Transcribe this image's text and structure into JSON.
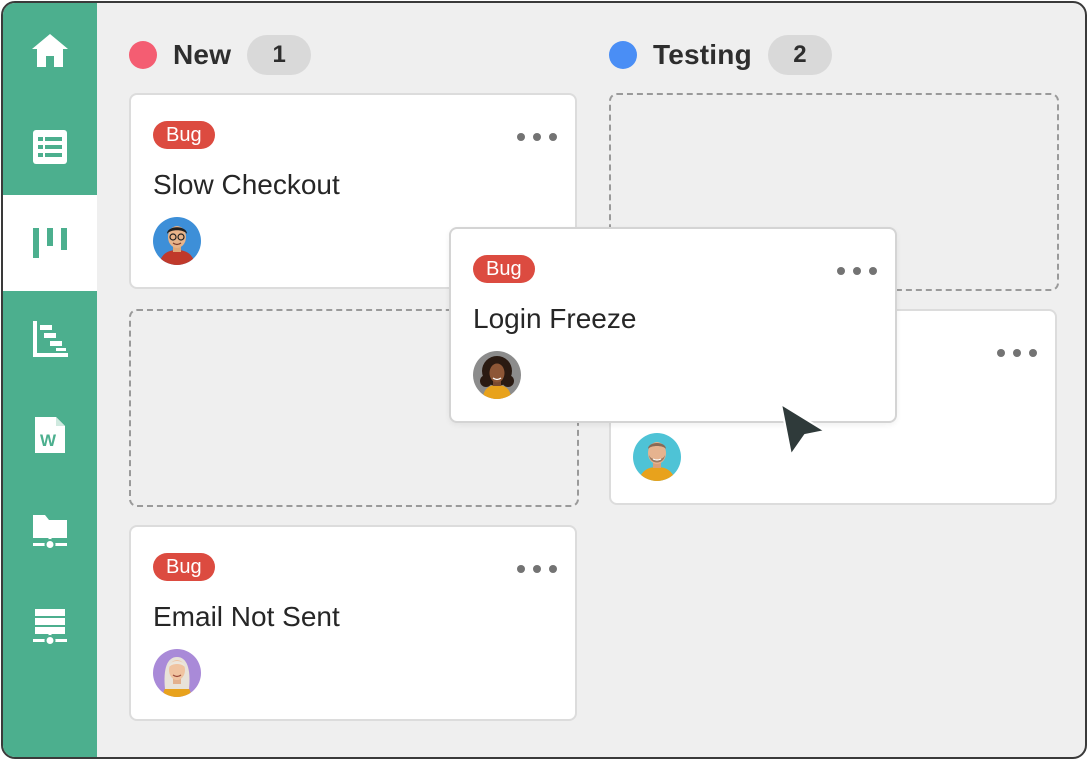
{
  "sidebar": {
    "items": [
      {
        "icon": "home-icon"
      },
      {
        "icon": "list-icon"
      },
      {
        "icon": "kanban-board-icon",
        "active": true
      },
      {
        "icon": "gantt-icon"
      },
      {
        "icon": "word-document-icon",
        "letter": "W"
      },
      {
        "icon": "shared-folder-icon"
      },
      {
        "icon": "network-server-icon"
      }
    ]
  },
  "columns": [
    {
      "title": "New",
      "count": "1",
      "color": "#f45d72",
      "cards": [
        {
          "badge": "Bug",
          "title": "Slow Checkout",
          "avatar": "avatar-man-glasses"
        },
        {
          "badge": "Bug",
          "title": "Email Not Sent",
          "avatar": "avatar-woman-blonde"
        }
      ]
    },
    {
      "title": "Testing",
      "count": "2",
      "color": "#4a8ef5",
      "cards": [
        {
          "avatar": "avatar-man-beard"
        }
      ]
    }
  ],
  "dragged_card": {
    "badge": "Bug",
    "title": "Login Freeze",
    "avatar": "avatar-woman-curly"
  },
  "colors": {
    "sidebar": "#4caf8e",
    "badge": "#dc4b40",
    "background": "#efefef"
  }
}
